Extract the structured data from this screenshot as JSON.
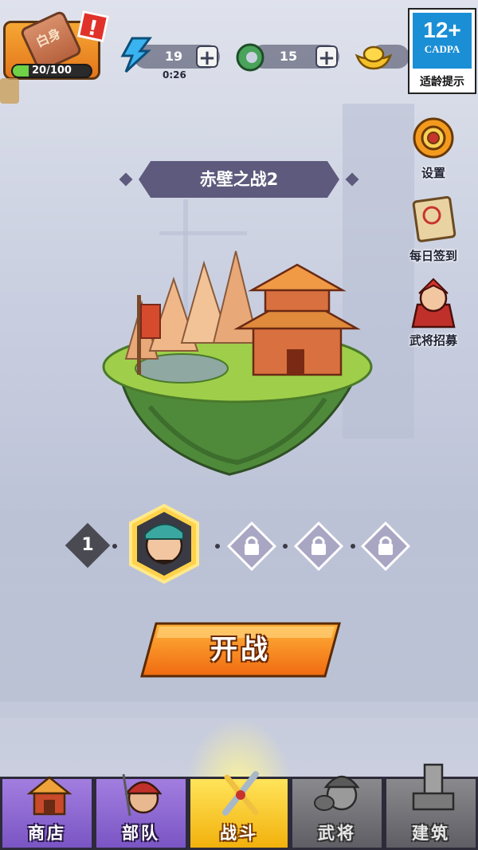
{
  "player": {
    "rank_label": "白身",
    "exp_text": "20/100",
    "exp_fraction": 0.2,
    "alert": "!"
  },
  "resources": {
    "energy": {
      "icon": "lightning-icon",
      "value": "19",
      "timer": "0:26"
    },
    "jade": {
      "icon": "jade-coin-icon",
      "value": "15"
    },
    "gold": {
      "icon": "gold-ingot-icon"
    }
  },
  "age_rating": {
    "age": "12+",
    "org": "CADPA",
    "tip": "适龄提示"
  },
  "side_menu": [
    {
      "label": "设置",
      "icon": "gear-icon"
    },
    {
      "label": "每日签到",
      "icon": "scroll-icon"
    },
    {
      "label": "武将招募",
      "icon": "warrior-icon"
    }
  ],
  "stage": {
    "title": "赤壁之战2",
    "current_node": "1"
  },
  "start_button": {
    "label": "开战"
  },
  "nav": [
    {
      "label": "商店",
      "icon": "shop-icon"
    },
    {
      "label": "部队",
      "icon": "army-icon"
    },
    {
      "label": "战斗",
      "icon": "battle-swords-icon"
    },
    {
      "label": "武将",
      "icon": "general-icon"
    },
    {
      "label": "建筑",
      "icon": "building-icon"
    }
  ],
  "colors": {
    "accent_orange": "#f28a1c",
    "banner": "#5e5a7d",
    "nav_purple": "#8d6ad1",
    "nav_active": "#ffd21f",
    "exp_green": "#6fd145"
  }
}
